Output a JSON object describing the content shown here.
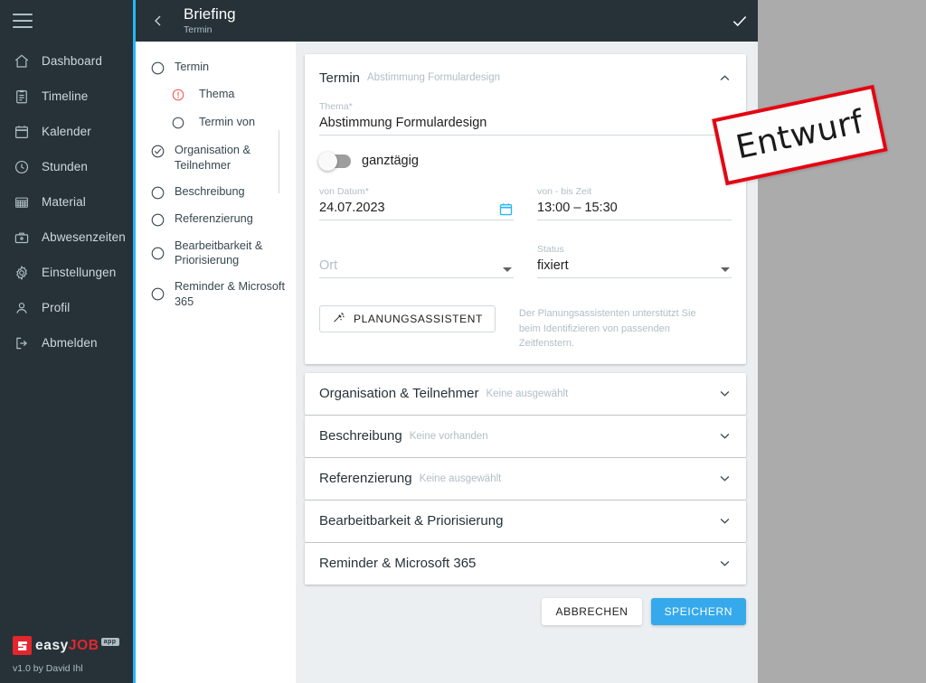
{
  "sidebar": {
    "menu_icon": "hamburger-icon",
    "items": [
      {
        "label": "Dashboard",
        "icon": "home-icon"
      },
      {
        "label": "Timeline",
        "icon": "clipboard-icon"
      },
      {
        "label": "Kalender",
        "icon": "calendar-icon"
      },
      {
        "label": "Stunden",
        "icon": "clock-icon"
      },
      {
        "label": "Material",
        "icon": "grid-icon"
      },
      {
        "label": "Abwesenzeiten",
        "icon": "briefcase-icon"
      },
      {
        "label": "Einstellungen",
        "icon": "gear-icon"
      },
      {
        "label": "Profil",
        "icon": "person-icon"
      },
      {
        "label": "Abmelden",
        "icon": "logout-icon"
      }
    ],
    "logo": {
      "text_easy": "easy",
      "text_job": "JOB",
      "badge": "app"
    },
    "version": "v1.0 by David Ihl"
  },
  "topbar": {
    "back_icon": "chevron-left-icon",
    "title": "Briefing",
    "subtitle": "Termin",
    "confirm_icon": "check-icon"
  },
  "stepper": {
    "items": [
      {
        "label": "Termin",
        "state": "empty",
        "sub": false
      },
      {
        "label": "Thema",
        "state": "error",
        "sub": true
      },
      {
        "label": "Termin von",
        "state": "empty",
        "sub": true
      },
      {
        "label": "Organisation & Teilnehmer",
        "state": "done",
        "sub": false
      },
      {
        "label": "Beschreibung",
        "state": "empty",
        "sub": false
      },
      {
        "label": "Referenzierung",
        "state": "empty",
        "sub": false
      },
      {
        "label": "Bearbeitbarkeit & Priorisierung",
        "state": "empty",
        "sub": false
      },
      {
        "label": "Reminder & Microsoft 365",
        "state": "empty",
        "sub": false
      }
    ]
  },
  "termin_card": {
    "title": "Termin",
    "subtitle": "Abstimmung Formulardesign",
    "collapse_icon": "chevron-up-icon",
    "thema": {
      "label": "Thema*",
      "value": "Abstimmung Formulardesign"
    },
    "ganztaegig": {
      "label": "ganztägig",
      "checked": false
    },
    "von_datum": {
      "label": "von Datum*",
      "value": "24.07.2023",
      "icon": "calendar-picker-icon"
    },
    "von_bis_zeit": {
      "label": "von - bis Zeit",
      "value": "13:00 – 15:30"
    },
    "ort": {
      "label": "Ort",
      "value": "",
      "placeholder": "Ort"
    },
    "status": {
      "label": "Status",
      "value": "fixiert"
    },
    "assistant_button": {
      "label": "PLANUNGSASSISTENT",
      "icon": "magic-wand-icon"
    },
    "assistant_help": "Der Planungsassistenten unterstützt Sie beim Identifizieren von passenden Zeitfenstern."
  },
  "sections": [
    {
      "title": "Organisation & Teilnehmer",
      "hint": "Keine ausgewählt",
      "icon": "chevron-down-icon"
    },
    {
      "title": "Beschreibung",
      "hint": "Keine vorhanden",
      "icon": "chevron-down-icon"
    },
    {
      "title": "Referenzierung",
      "hint": "Keine ausgewählt",
      "icon": "chevron-down-icon"
    },
    {
      "title": "Bearbeitbarkeit & Priorisierung",
      "hint": "",
      "icon": "chevron-down-icon"
    },
    {
      "title": "Reminder & Microsoft 365",
      "hint": "",
      "icon": "chevron-down-icon"
    }
  ],
  "footer": {
    "cancel": "ABBRECHEN",
    "save": "SPEICHERN"
  },
  "stamp": {
    "text": "Entwurf"
  },
  "colors": {
    "sidebar_bg": "#263238",
    "accent_blue": "#29b6f6",
    "primary_blue": "#35a9eb",
    "stamp_red": "#e30613",
    "error_red": "#ef5350",
    "backdrop_grey": "#ababab",
    "content_bg": "#eceff1"
  }
}
